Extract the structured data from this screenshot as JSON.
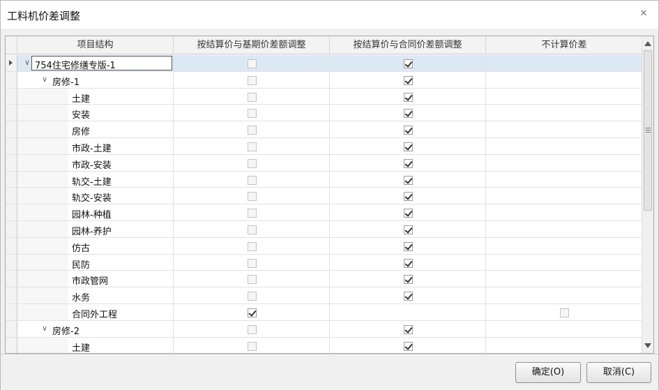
{
  "window": {
    "title": "工料机价差调整"
  },
  "columns": [
    "项目结构",
    "按结算价与基期价差额调整",
    "按结算价与合同价差额调整",
    "不计算价差"
  ],
  "rows": [
    {
      "name": "754住宅修缮专版-1",
      "level": 0,
      "expander": "∨",
      "selected": true,
      "editing": true,
      "c1": "unchecked",
      "c2": "checked",
      "c3": "none"
    },
    {
      "name": "房修-1",
      "level": 1,
      "expander": "∨",
      "c1": "unchecked",
      "c2": "checked",
      "c3": "none"
    },
    {
      "name": "土建",
      "level": 2,
      "c1": "unchecked",
      "c2": "checked",
      "c3": "none"
    },
    {
      "name": "安装",
      "level": 2,
      "c1": "unchecked",
      "c2": "checked",
      "c3": "none"
    },
    {
      "name": "房修",
      "level": 2,
      "c1": "unchecked",
      "c2": "checked",
      "c3": "none"
    },
    {
      "name": "市政-土建",
      "level": 2,
      "c1": "unchecked",
      "c2": "checked",
      "c3": "none"
    },
    {
      "name": "市政-安装",
      "level": 2,
      "c1": "unchecked",
      "c2": "checked",
      "c3": "none"
    },
    {
      "name": "轨交-土建",
      "level": 2,
      "c1": "unchecked",
      "c2": "checked",
      "c3": "none"
    },
    {
      "name": "轨交-安装",
      "level": 2,
      "c1": "unchecked",
      "c2": "checked",
      "c3": "none"
    },
    {
      "name": "园林-种植",
      "level": 2,
      "c1": "unchecked",
      "c2": "checked",
      "c3": "none"
    },
    {
      "name": "园林-养护",
      "level": 2,
      "c1": "unchecked",
      "c2": "checked",
      "c3": "none"
    },
    {
      "name": "仿古",
      "level": 2,
      "c1": "unchecked",
      "c2": "checked",
      "c3": "none"
    },
    {
      "name": "民防",
      "level": 2,
      "c1": "unchecked",
      "c2": "checked",
      "c3": "none"
    },
    {
      "name": "市政管网",
      "level": 2,
      "c1": "unchecked",
      "c2": "checked",
      "c3": "none"
    },
    {
      "name": "水务",
      "level": 2,
      "c1": "unchecked",
      "c2": "checked",
      "c3": "none"
    },
    {
      "name": "合同外工程",
      "level": 2,
      "c1": "checked",
      "c2": "none",
      "c3": "unchecked"
    },
    {
      "name": "房修-2",
      "level": 1,
      "expander": "∨",
      "c1": "unchecked",
      "c2": "checked",
      "c3": "none"
    },
    {
      "name": "土建",
      "level": 2,
      "c1": "unchecked",
      "c2": "checked",
      "c3": "none"
    }
  ],
  "buttons": {
    "ok": "确定(O)",
    "cancel": "取消(C)"
  },
  "icons": {
    "close": "close-icon",
    "row_indicator": "row-pointer-icon",
    "expander": "chevron-down-icon",
    "checkbox": "checkbox-icon"
  },
  "colors": {
    "selected_row": "#dde8f5",
    "header": "#f3f3f3"
  }
}
